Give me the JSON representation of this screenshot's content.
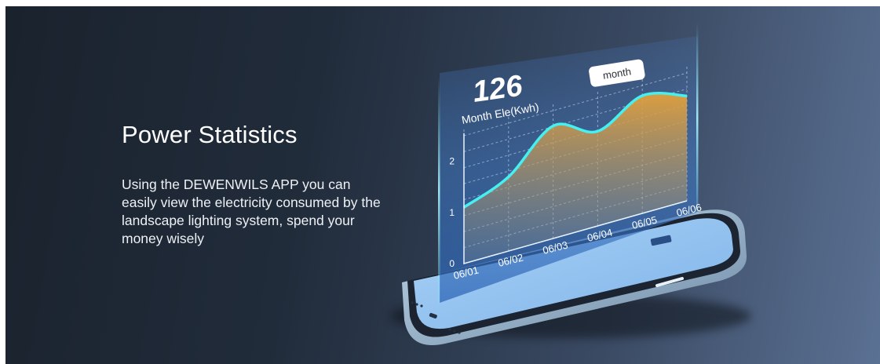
{
  "banner": {
    "title": "Power Statistics",
    "description": "Using the DEWENWILS APP you can easily view the electricity consumed by the landscape lighting system, spend your money wisely"
  },
  "stats_card": {
    "value": "126",
    "value_label": "Month Ele(Kwh)",
    "period_button": "month"
  },
  "chart_data": {
    "type": "area",
    "x": [
      "06/01",
      "06/02",
      "06/03",
      "06/04",
      "06/05",
      "06/06"
    ],
    "y_ticks": [
      "0",
      "1",
      "2"
    ],
    "ylim": [
      0,
      2.5
    ],
    "values": [
      1.1,
      1.45,
      2.2,
      1.85,
      2.3,
      2.05
    ],
    "grid": true
  },
  "colors": {
    "line": "#46f0f0",
    "fill_top": "#d79a3c",
    "panel": "#3f78c4"
  }
}
